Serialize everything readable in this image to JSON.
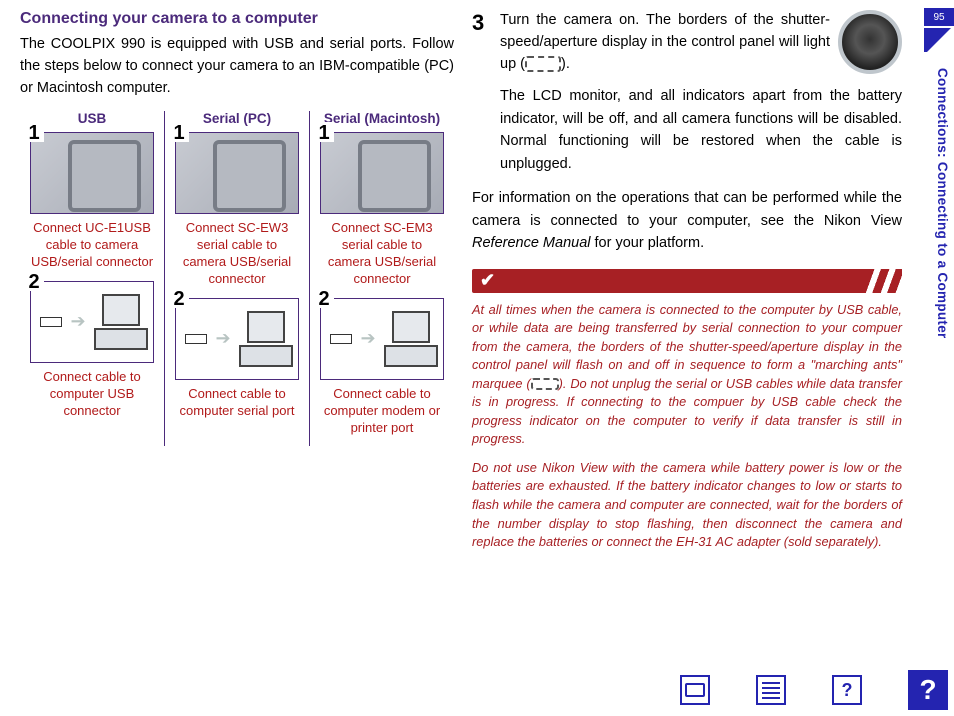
{
  "header": {
    "title": "Connecting your camera to a computer",
    "intro": "The COOLPIX 990 is equipped with USB and serial ports. Follow the steps below to connect your camera to an IBM-compatible (PC) or Macintosh computer."
  },
  "columns": [
    {
      "head": "USB",
      "step1_caption": "Connect UC-E1USB cable to camera USB/serial connector",
      "step2_caption": "Connect cable to computer USB connector"
    },
    {
      "head": "Serial (PC)",
      "step1_caption": "Connect SC-EW3 serial cable to camera USB/serial connector",
      "step2_caption": "Connect cable to computer serial port"
    },
    {
      "head": "Serial (Macintosh)",
      "step1_caption": "Connect SC-EM3 serial cable to camera USB/serial connector",
      "step2_caption": "Connect cable to computer modem or printer port"
    }
  ],
  "steps": {
    "s1": "1",
    "s2": "2",
    "s3": "3"
  },
  "right": {
    "step3a": "Turn the camera on. The borders of the shutter-speed/aperture display in the control panel will light up (",
    "step3a_end": ").",
    "step3b": "The LCD monitor, and all indicators apart from the battery indicator, will be off, and all camera functions will be disabled. Normal functioning will be restored when the cable is unplugged.",
    "para_ref_a": "For information on the operations that can be performed while the camera is connected to your computer, see the Nikon View ",
    "para_ref_em": "Reference Manual",
    "para_ref_b": " for your platform.",
    "note1a": "At all times when the camera is connected to the computer by USB cable, or while data are being transferred by serial connection to your compuer from the camera, the borders of the shutter-speed/aperture display in the control panel will flash on and off in sequence to form a \"marching ants\" marquee (",
    "note1b": "). Do not unplug the serial or USB cables while data transfer is in progress. If connecting to the compuer by USB cable check the progress indicator on the computer to verify if data transfer is still in progress.",
    "note2": "Do not use Nikon View with the camera while battery power is low or the batteries are exhausted. If the battery indicator changes to low or starts to flash while the camera and computer are connected, wait for the borders of the number display to stop flashing, then disconnect the camera and replace the batteries or connect the EH-31 AC adapter (sold separately)."
  },
  "side": {
    "page": "95",
    "label": "Connections: Connecting to a Computer"
  },
  "icons": {
    "q": "?",
    "check": "✔"
  }
}
